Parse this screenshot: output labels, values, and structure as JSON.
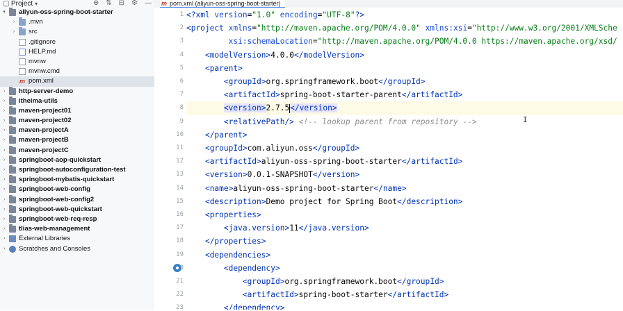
{
  "project_panel": {
    "title": "Project",
    "tree": [
      {
        "label": "aliyun-oss-spring-boot-starter",
        "kind": "module",
        "bold": true,
        "depth": 0,
        "expanded": true
      },
      {
        "label": ".mvn",
        "kind": "folder",
        "bold": false,
        "depth": 1,
        "expanded": false
      },
      {
        "label": "src",
        "kind": "folder",
        "bold": false,
        "depth": 1,
        "expanded": false
      },
      {
        "label": ".gitignore",
        "kind": "file",
        "bold": false,
        "depth": 1
      },
      {
        "label": "HELP.md",
        "kind": "md",
        "bold": false,
        "depth": 1
      },
      {
        "label": "mvnw",
        "kind": "file",
        "bold": false,
        "depth": 1
      },
      {
        "label": "mvnw.cmd",
        "kind": "file",
        "bold": false,
        "depth": 1
      },
      {
        "label": "pom.xml",
        "kind": "maven",
        "bold": false,
        "depth": 1,
        "selected": true
      },
      {
        "label": "http-server-demo",
        "kind": "module",
        "bold": true,
        "depth": 0,
        "expanded": false
      },
      {
        "label": "itheima-utils",
        "kind": "module",
        "bold": true,
        "depth": 0,
        "expanded": false
      },
      {
        "label": "maven-project01",
        "kind": "module",
        "bold": true,
        "depth": 0,
        "expanded": false
      },
      {
        "label": "maven-project02",
        "kind": "module",
        "bold": true,
        "depth": 0,
        "expanded": false
      },
      {
        "label": "maven-projectA",
        "kind": "module",
        "bold": true,
        "depth": 0,
        "expanded": false
      },
      {
        "label": "maven-projectB",
        "kind": "module",
        "bold": true,
        "depth": 0,
        "expanded": false
      },
      {
        "label": "maven-projectC",
        "kind": "module",
        "bold": true,
        "depth": 0,
        "expanded": false
      },
      {
        "label": "springboot-aop-quickstart",
        "kind": "module",
        "bold": true,
        "depth": 0,
        "expanded": false
      },
      {
        "label": "springboot-autoconfiguration-test",
        "kind": "module",
        "bold": true,
        "depth": 0,
        "expanded": false
      },
      {
        "label": "springboot-mybatis-quickstart",
        "kind": "module",
        "bold": true,
        "depth": 0,
        "expanded": false
      },
      {
        "label": "springboot-web-config",
        "kind": "module",
        "bold": true,
        "depth": 0,
        "expanded": false
      },
      {
        "label": "springboot-web-config2",
        "kind": "module",
        "bold": true,
        "depth": 0,
        "expanded": false
      },
      {
        "label": "springboot-web-quickstart",
        "kind": "module",
        "bold": true,
        "depth": 0,
        "expanded": false
      },
      {
        "label": "springboot-web-req-resp",
        "kind": "module",
        "bold": true,
        "depth": 0,
        "expanded": false
      },
      {
        "label": "tlias-web-management",
        "kind": "module",
        "bold": true,
        "depth": 0,
        "expanded": false
      },
      {
        "label": "External Libraries",
        "kind": "library",
        "bold": false,
        "depth": 0,
        "expanded": false
      },
      {
        "label": "Scratches and Consoles",
        "kind": "scratch",
        "bold": false,
        "depth": 0,
        "expanded": false
      }
    ]
  },
  "editor": {
    "tab_label": "pom.xml (aliyun-oss-spring-boot-starter)",
    "current_line": 8,
    "lines": [
      {
        "n": "1",
        "segs": [
          [
            "tg",
            "<?xml "
          ],
          [
            "at",
            "version"
          ],
          [
            "t",
            "="
          ],
          [
            "st",
            "\"1.0\""
          ],
          [
            "t",
            " "
          ],
          [
            "at",
            "encoding"
          ],
          [
            "t",
            "="
          ],
          [
            "st",
            "\"UTF-8\""
          ],
          [
            "tg",
            "?>"
          ]
        ]
      },
      {
        "n": "2",
        "segs": [
          [
            "tg",
            "<project "
          ],
          [
            "at",
            "xmlns"
          ],
          [
            "t",
            "="
          ],
          [
            "st",
            "\"http://maven.apache.org/POM/4.0.0\""
          ],
          [
            "t",
            " "
          ],
          [
            "at",
            "xmlns:xsi"
          ],
          [
            "t",
            "="
          ],
          [
            "st",
            "\"http://www.w3.org/2001/XMLSche"
          ]
        ]
      },
      {
        "n": "3",
        "segs": [
          [
            "t",
            "         "
          ],
          [
            "at",
            "xsi:schemaLocation"
          ],
          [
            "t",
            "="
          ],
          [
            "st",
            "\"http://maven.apache.org/POM/4.0.0 https://maven.apache.org/xsd/"
          ]
        ]
      },
      {
        "n": "4",
        "segs": [
          [
            "t",
            "    "
          ],
          [
            "tg",
            "<modelVersion>"
          ],
          [
            "t",
            "4.0.0"
          ],
          [
            "tg",
            "</modelVersion>"
          ]
        ]
      },
      {
        "n": "5",
        "segs": [
          [
            "t",
            "    "
          ],
          [
            "tg",
            "<parent>"
          ]
        ]
      },
      {
        "n": "6",
        "segs": [
          [
            "t",
            "        "
          ],
          [
            "tg",
            "<groupId>"
          ],
          [
            "t",
            "org.springframework.boot"
          ],
          [
            "tg",
            "</groupId>"
          ]
        ]
      },
      {
        "n": "7",
        "segs": [
          [
            "t",
            "        "
          ],
          [
            "tg",
            "<artifactId>"
          ],
          [
            "t",
            "spring-boot-starter-parent"
          ],
          [
            "tg",
            "</artifactId>"
          ]
        ]
      },
      {
        "n": "8",
        "segs": [
          [
            "t",
            "        "
          ],
          [
            "tgh",
            "<version>"
          ],
          [
            "t",
            "2.7.5"
          ],
          [
            "caret",
            ""
          ],
          [
            "tgh",
            "</version>"
          ]
        ]
      },
      {
        "n": "9",
        "segs": [
          [
            "t",
            "        "
          ],
          [
            "tg",
            "<relativePath/>"
          ],
          [
            "t",
            " "
          ],
          [
            "cm",
            "<!-- lookup parent from repository -->"
          ]
        ]
      },
      {
        "n": "10",
        "segs": [
          [
            "t",
            "    "
          ],
          [
            "tg",
            "</parent>"
          ]
        ]
      },
      {
        "n": "11",
        "segs": [
          [
            "t",
            "    "
          ],
          [
            "tg",
            "<groupId>"
          ],
          [
            "t",
            "com.aliyun.oss"
          ],
          [
            "tg",
            "</groupId>"
          ]
        ]
      },
      {
        "n": "12",
        "segs": [
          [
            "t",
            "    "
          ],
          [
            "tg",
            "<artifactId>"
          ],
          [
            "t",
            "aliyun-oss-spring-boot-starter"
          ],
          [
            "tg",
            "</artifactId>"
          ]
        ]
      },
      {
        "n": "13",
        "segs": [
          [
            "t",
            "    "
          ],
          [
            "tg",
            "<version>"
          ],
          [
            "t",
            "0.0.1-SNAPSHOT"
          ],
          [
            "tg",
            "</version>"
          ]
        ]
      },
      {
        "n": "14",
        "segs": [
          [
            "t",
            "    "
          ],
          [
            "tg",
            "<name>"
          ],
          [
            "t",
            "aliyun-oss-spring-boot-starter"
          ],
          [
            "tg",
            "</name>"
          ]
        ]
      },
      {
        "n": "15",
        "segs": [
          [
            "t",
            "    "
          ],
          [
            "tg",
            "<description>"
          ],
          [
            "t",
            "Demo project for Spring Boot"
          ],
          [
            "tg",
            "</description>"
          ]
        ]
      },
      {
        "n": "16",
        "segs": [
          [
            "t",
            "    "
          ],
          [
            "tg",
            "<properties>"
          ]
        ]
      },
      {
        "n": "17",
        "segs": [
          [
            "t",
            "        "
          ],
          [
            "tg",
            "<java.version>"
          ],
          [
            "t",
            "11"
          ],
          [
            "tg",
            "</java.version>"
          ]
        ]
      },
      {
        "n": "18",
        "segs": [
          [
            "t",
            "    "
          ],
          [
            "tg",
            "</properties>"
          ]
        ]
      },
      {
        "n": "19",
        "segs": [
          [
            "t",
            "    "
          ],
          [
            "tg",
            "<dependencies>"
          ]
        ]
      },
      {
        "n": "20",
        "segs": [
          [
            "t",
            "        "
          ],
          [
            "tg",
            "<dependency>"
          ]
        ],
        "gutter_icon": true
      },
      {
        "n": "21",
        "segs": [
          [
            "t",
            "            "
          ],
          [
            "tg",
            "<groupId>"
          ],
          [
            "t",
            "org.springframework.boot"
          ],
          [
            "tg",
            "</groupId>"
          ]
        ]
      },
      {
        "n": "22",
        "segs": [
          [
            "t",
            "            "
          ],
          [
            "tg",
            "<artifactId>"
          ],
          [
            "t",
            "spring-boot-starter"
          ],
          [
            "tg",
            "</artifactId>"
          ]
        ]
      },
      {
        "n": "23",
        "segs": [
          [
            "t",
            "        "
          ],
          [
            "tg",
            "</dependency>"
          ]
        ]
      }
    ]
  },
  "colors": {
    "tag": "#0033b3",
    "attribute": "#174ad4",
    "string": "#067d17",
    "comment": "#8c8c8c",
    "selection": "#dfe3ea",
    "current_line": "#fdfbe6"
  }
}
